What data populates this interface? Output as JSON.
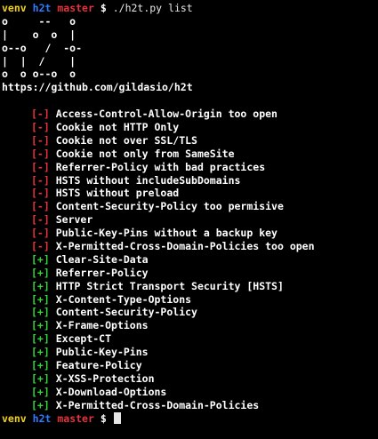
{
  "prompt": {
    "venv": "venv",
    "dir": "h2t",
    "branch": "master",
    "symbol": "$",
    "command": "./h2t.py list"
  },
  "ascii_logo": [
    "o     --   o",
    "|    o  o  |",
    "o--o   /  -o-",
    "|  |  /    |",
    "o  o o--o  o"
  ],
  "url": "https://github.com/gildasio/h2t",
  "bad_marker": "[-]",
  "good_marker": "[+]",
  "bad_items": [
    "Access-Control-Allow-Origin too open",
    "Cookie not HTTP Only",
    "Cookie not over SSL/TLS",
    "Cookie not only from SameSite",
    "Referrer-Policy with bad practices",
    "HSTS without includeSubDomains",
    "HSTS without preload",
    "Content-Security-Policy too permisive",
    "Server",
    "Public-Key-Pins without a backup key",
    "X-Permitted-Cross-Domain-Policies too open"
  ],
  "good_items": [
    "Clear-Site-Data",
    "Referrer-Policy",
    "HTTP Strict Transport Security [HSTS]",
    "X-Content-Type-Options",
    "Content-Security-Policy",
    "X-Frame-Options",
    "Except-CT",
    "Public-Key-Pins",
    "Feature-Policy",
    "X-XSS-Protection",
    "X-Download-Options",
    "X-Permitted-Cross-Domain-Policies"
  ],
  "colors": {
    "background": "#000000",
    "venv": "#f2d21b",
    "dir": "#2f7bff",
    "branch": "#e8323b",
    "bad": "#e8323b",
    "good": "#34d33a"
  }
}
